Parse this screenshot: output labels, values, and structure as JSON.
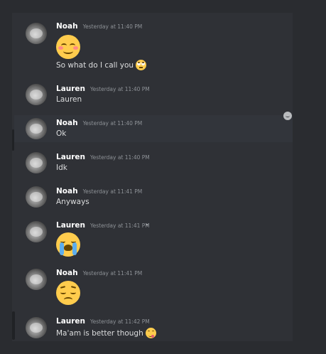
{
  "messages": [
    {
      "author": "Noah",
      "timestamp": "Yesterday at 11:40 PM",
      "text": "",
      "emoji": "smiling-face-with-blush"
    },
    {
      "author": "",
      "timestamp": "",
      "text": "So what do I call you",
      "emoji": "face-with-rolling-eyes"
    },
    {
      "author": "Lauren",
      "timestamp": "Yesterday at 11:40 PM",
      "text": "Lauren"
    },
    {
      "author": "Noah",
      "timestamp": "Yesterday at 11:40 PM",
      "text": "Ok"
    },
    {
      "author": "Lauren",
      "timestamp": "Yesterday at 11:40 PM",
      "text": "Idk"
    },
    {
      "author": "Noah",
      "timestamp": "Yesterday at 11:41 PM",
      "text": "Anyways"
    },
    {
      "author": "Lauren",
      "timestamp": "Yesterday at 11:41 PM",
      "text": "",
      "emoji": "loudly-crying-face"
    },
    {
      "author": "Noah",
      "timestamp": "Yesterday at 11:41 PM",
      "text": "",
      "emoji": "pensive-face"
    },
    {
      "author": "Lauren",
      "timestamp": "Yesterday at 11:42 PM",
      "text": "Ma'am is better though",
      "emoji": "face-savoring-food"
    }
  ],
  "colors": {
    "background": "#2f3136",
    "hover": "#32353b",
    "username": "#ffffff",
    "timestamp": "#8e9297",
    "text": "#dcddde"
  }
}
